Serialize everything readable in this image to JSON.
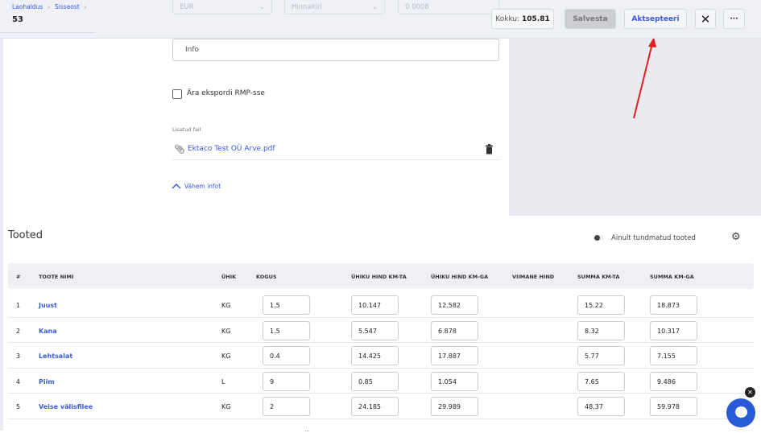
{
  "header": {
    "breadcrumb": [
      "Laohaldus",
      "Sisseost"
    ],
    "doc_number": "53",
    "currency": "EUR",
    "pricelist_placeholder": "Hinnakiri",
    "rate": "0.0008",
    "total_label": "Kokku:",
    "total_value": "105.81",
    "save_label": "Salvesta",
    "accept_label": "Aktsepteeri"
  },
  "form": {
    "info_placeholder": "Info",
    "no_export_label": "Ära ekspordi RMP-sse",
    "attached_label": "Lisatud fail",
    "file_name": "Ektaco Test OÜ Arve.pdf",
    "less_info": "Vähem infot"
  },
  "products": {
    "title": "Tooted",
    "toggle_label": "Ainult tundmatud tooted",
    "columns": [
      "#",
      "TOOTE NIMI",
      "ÜHIK",
      "KOGUS",
      "ÜHIKU HIND KM-TA",
      "ÜHIKU HIND KM-GA",
      "VIIMANE HIND",
      "SUMMA KM-TA",
      "SUMMA KM-GA"
    ],
    "rows": [
      {
        "n": "1",
        "name": "Juust",
        "unit": "KG",
        "qty": "1.5",
        "price_ex": "10.147",
        "price_inc": "12.582",
        "sum_ex": "15.22",
        "sum_inc": "18.873"
      },
      {
        "n": "2",
        "name": "Kana",
        "unit": "KG",
        "qty": "1.5",
        "price_ex": "5.547",
        "price_inc": "6.878",
        "sum_ex": "8.32",
        "sum_inc": "10.317"
      },
      {
        "n": "3",
        "name": "Lehtsalat",
        "unit": "KG",
        "qty": "0.4",
        "price_ex": "14.425",
        "price_inc": "17.887",
        "sum_ex": "5.77",
        "sum_inc": "7.155"
      },
      {
        "n": "4",
        "name": "Piim",
        "unit": "L",
        "qty": "9",
        "price_ex": "0.85",
        "price_inc": "1.054",
        "sum_ex": "7.65",
        "sum_inc": "9.486"
      },
      {
        "n": "5",
        "name": "Veise välisfilee",
        "unit": "KG",
        "qty": "2",
        "price_ex": "24.185",
        "price_inc": "29.989",
        "sum_ex": "48.37",
        "sum_inc": "59.978"
      }
    ]
  },
  "colors": {
    "accent": "#3b5bdb",
    "arrow": "#e02020",
    "chat": "#2a5bd7"
  }
}
